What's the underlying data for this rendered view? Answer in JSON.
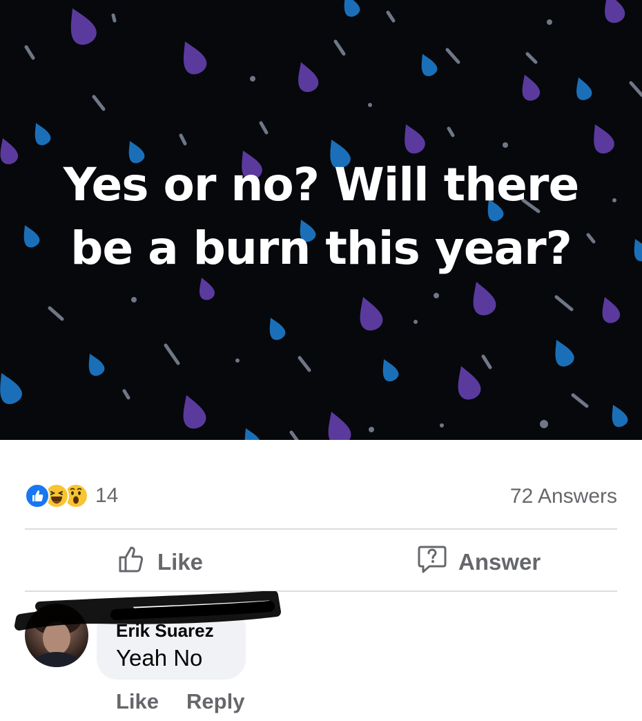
{
  "post": {
    "question": "Yes or no? Will there be a burn this year?",
    "colors": {
      "background": "#06080c",
      "drop_purple": "#5b3a9e",
      "drop_blue": "#1b6fb8",
      "streak": "#7d8494"
    }
  },
  "stats": {
    "reaction_icons": [
      "like-icon",
      "haha-icon",
      "wow-icon"
    ],
    "reaction_count": "14",
    "answers_count": "72 Answers"
  },
  "actions": {
    "like_label": "Like",
    "answer_label": "Answer"
  },
  "comment": {
    "author": "Erik Suarez",
    "text": "Yeah No",
    "like_label": "Like",
    "reply_label": "Reply"
  }
}
